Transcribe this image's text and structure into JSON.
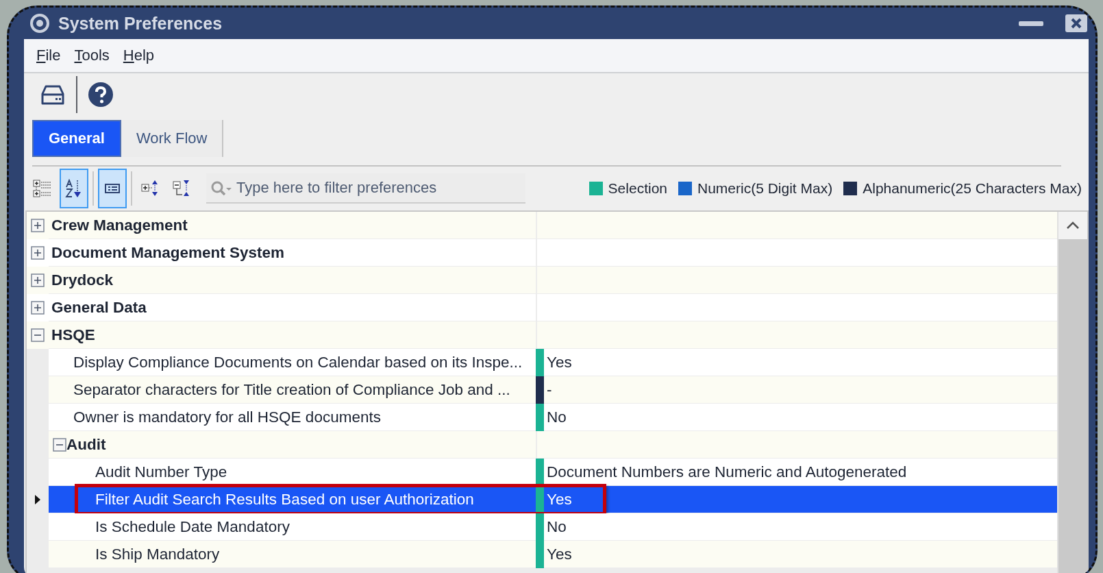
{
  "window": {
    "title": "System Preferences"
  },
  "menu": [
    {
      "label": "File"
    },
    {
      "label": "Tools"
    },
    {
      "label": "Help"
    }
  ],
  "toolbar": [
    {
      "kind": "save"
    },
    {
      "kind": "help"
    }
  ],
  "tabs": [
    {
      "label": "General",
      "selected": true
    },
    {
      "label": "Work Flow",
      "selected": false
    }
  ],
  "view_tools": [
    {
      "kind": "categorized",
      "on": false
    },
    {
      "kind": "alphabetical",
      "on": true
    },
    {
      "kind": "description",
      "on": true
    },
    {
      "kind": "expand-all",
      "on": false
    },
    {
      "kind": "collapse-all",
      "on": false
    }
  ],
  "search": {
    "placeholder": "Type here to filter preferences"
  },
  "legend": [
    {
      "label": "Selection",
      "color": "#1bb394"
    },
    {
      "label": "Numeric(5 Digit Max)",
      "color": "#1a66c9"
    },
    {
      "label": "Alphanumeric(25 Characters Max)",
      "color": "#1f2d4d"
    }
  ],
  "rows": [
    {
      "kind": "group",
      "name": "Crew Management",
      "expanded": false
    },
    {
      "kind": "group",
      "name": "Document Management System",
      "expanded": false
    },
    {
      "kind": "group",
      "name": "Drydock",
      "expanded": false
    },
    {
      "kind": "group",
      "name": "General Data",
      "expanded": false
    },
    {
      "kind": "group",
      "name": "HSQE",
      "expanded": true,
      "children": [
        {
          "kind": "item",
          "name": "Display Compliance Documents on Calendar based on its Inspe...",
          "value": "Yes",
          "color": "#1bb394",
          "selected": false,
          "annotated": false
        },
        {
          "kind": "item",
          "name": "Separator characters for Title creation of Compliance Job and ...",
          "value": "-",
          "color": "#1f2d4d",
          "selected": false,
          "annotated": false
        },
        {
          "kind": "item",
          "name": "Owner is mandatory for all HSQE documents",
          "value": "No",
          "color": "#1bb394",
          "selected": false,
          "annotated": false
        },
        {
          "kind": "group",
          "name": "Audit",
          "expanded": true,
          "children": [
            {
              "kind": "item",
              "name": "Audit Number Type",
              "value": "Document Numbers are Numeric and Autogenerated",
              "color": "#1bb394",
              "selected": false,
              "annotated": false
            },
            {
              "kind": "item",
              "name": "Filter Audit Search Results Based on user Authorization",
              "value": "Yes",
              "color": "#1bb394",
              "selected": true,
              "annotated": true
            },
            {
              "kind": "item",
              "name": "Is Schedule Date Mandatory",
              "value": "No",
              "color": "#1bb394",
              "selected": false,
              "annotated": false
            },
            {
              "kind": "item",
              "name": "Is Ship Mandatory",
              "value": "Yes",
              "color": "#1bb394",
              "selected": false,
              "annotated": false
            }
          ]
        }
      ]
    }
  ]
}
